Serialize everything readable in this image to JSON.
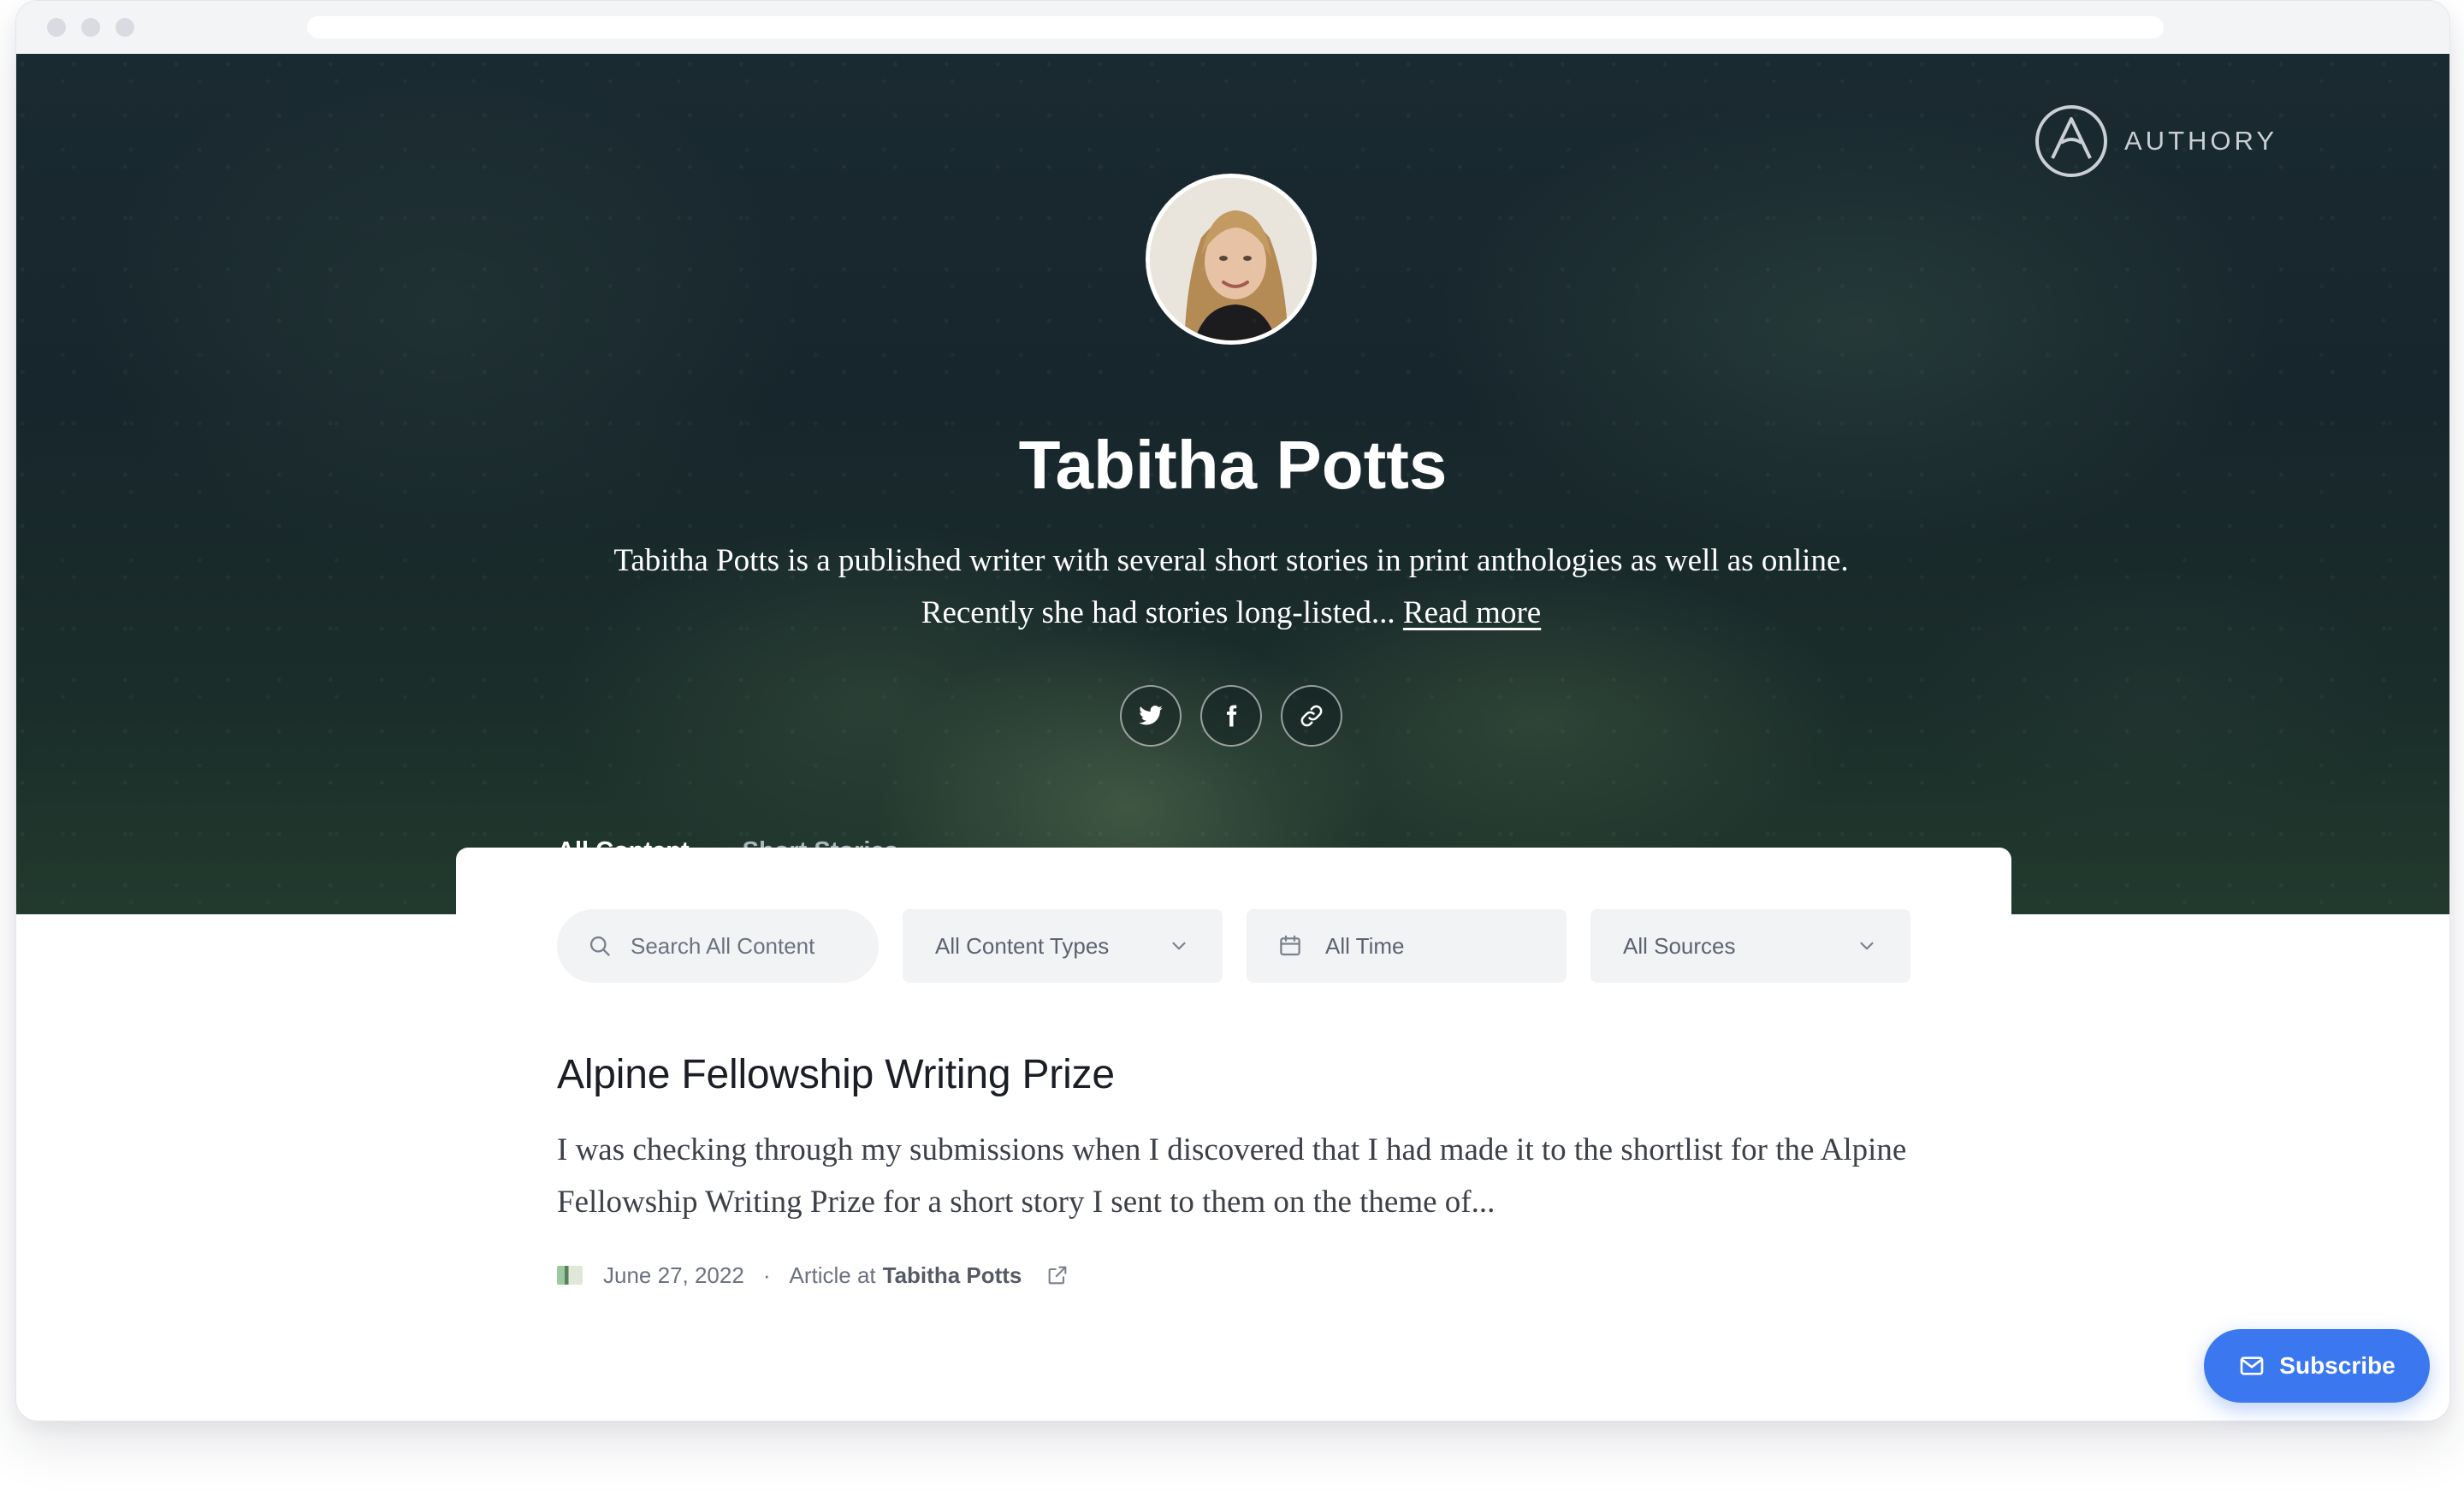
{
  "brand": {
    "name": "AUTHORY"
  },
  "profile": {
    "name": "Tabitha Potts",
    "bio": "Tabitha Potts is a published writer with several short stories in print anthologies as well as online. Recently she had stories long-listed...",
    "read_more": "Read more"
  },
  "social": [
    "twitter-icon",
    "facebook-icon",
    "link-icon"
  ],
  "tabs": [
    {
      "label": "All Content",
      "active": true
    },
    {
      "label": "Short Stories",
      "active": false
    }
  ],
  "filters": {
    "search_placeholder": "Search All Content",
    "content_types": "All Content Types",
    "time": "All Time",
    "sources": "All Sources"
  },
  "article": {
    "title": "Alpine Fellowship Writing Prize",
    "excerpt": "I was checking through my submissions when I discovered that I had made it to the shortlist for the Alpine Fellowship Writing Prize for a short story I sent to them on the theme of...",
    "date": "June 27, 2022",
    "separator": "·",
    "type_prefix": "Article at",
    "source": "Tabitha Potts"
  },
  "subscribe_label": "Subscribe",
  "colors": {
    "accent": "#3b78f0",
    "hero_dark": "#17262c",
    "text_dark": "#1b1e24"
  }
}
